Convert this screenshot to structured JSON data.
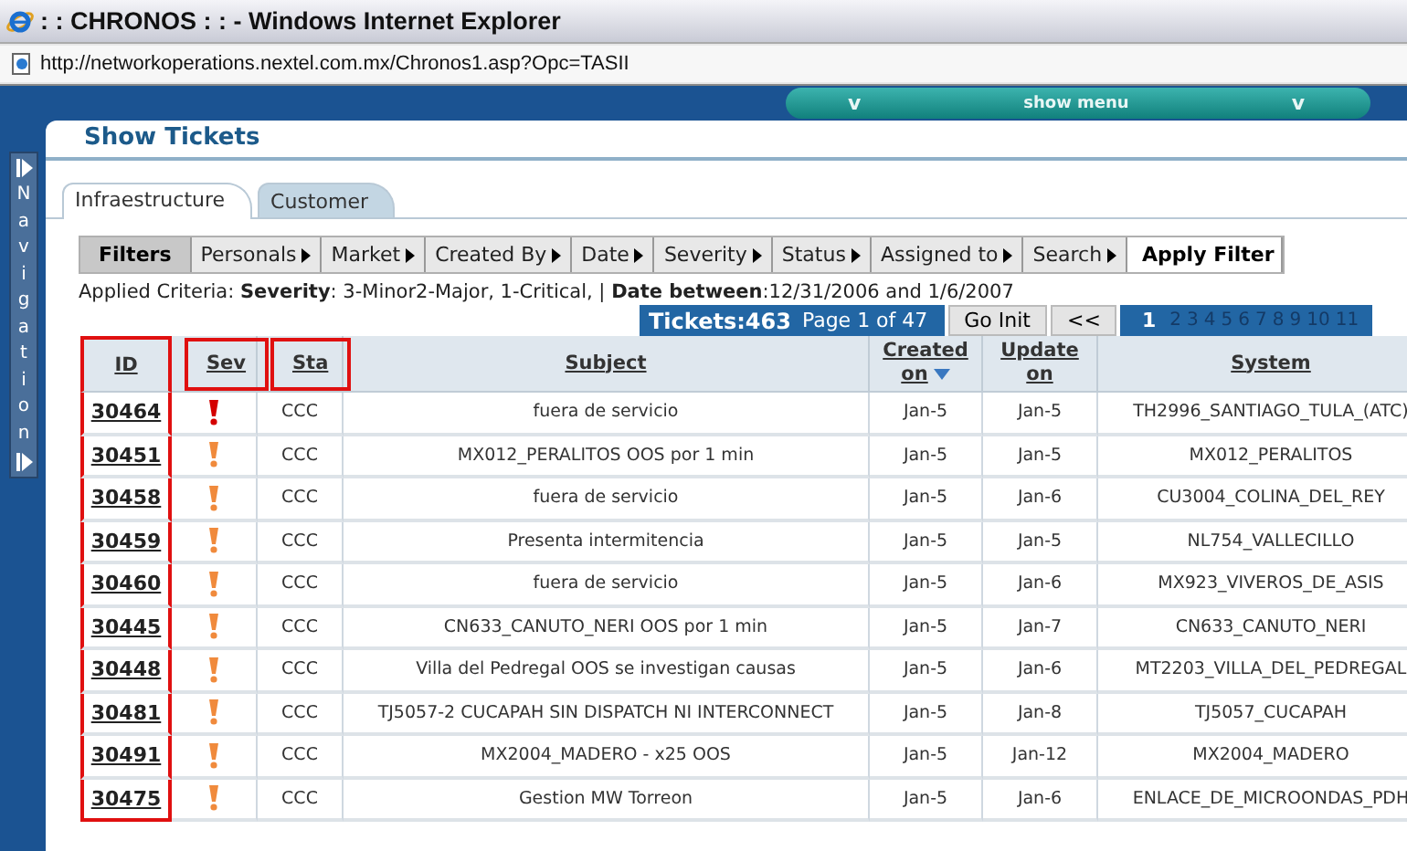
{
  "window": {
    "title": ": : CHRONOS : : - Windows Internet Explorer"
  },
  "address": "http://networkoperations.nextel.com.mx/Chronos1.asp?Opc=TASII",
  "menu_bar": {
    "left_icon": "v",
    "label": "show menu",
    "right_icon": "v"
  },
  "navigation": {
    "label": "Navigation"
  },
  "page_title": "Show Tickets",
  "tabs": [
    {
      "label": "Infraestructure",
      "selected": true
    },
    {
      "label": "Customer",
      "selected": false
    }
  ],
  "filters": [
    {
      "label": "Filters",
      "kind": "heading"
    },
    {
      "label": "Personals",
      "kind": "menu"
    },
    {
      "label": "Market",
      "kind": "menu"
    },
    {
      "label": "Created By",
      "kind": "menu"
    },
    {
      "label": "Date",
      "kind": "menu"
    },
    {
      "label": "Severity",
      "kind": "menu"
    },
    {
      "label": "Status",
      "kind": "menu"
    },
    {
      "label": "Assigned to",
      "kind": "menu"
    },
    {
      "label": "Search",
      "kind": "menu"
    },
    {
      "label": "Apply Filter",
      "kind": "action"
    }
  ],
  "applied_criteria": "Applied Criteria: **Severity**: 3-Minor2-Major, 1-Critical, | **Date between**:12/31/2006 and 1/6/2007",
  "pager": {
    "tickets": "Tickets:463",
    "page": "Page 1 of 47",
    "go_init": "Go Init",
    "prev": "<<",
    "pages": [
      {
        "label": "1",
        "selected": true
      },
      {
        "label": "2",
        "selected": false
      },
      {
        "label": "3",
        "selected": false
      },
      {
        "label": "4",
        "selected": false
      },
      {
        "label": "5",
        "selected": false
      },
      {
        "label": "6",
        "selected": false
      },
      {
        "label": "7",
        "selected": false
      },
      {
        "label": "8",
        "selected": false
      },
      {
        "label": "9",
        "selected": false
      },
      {
        "label": "10",
        "selected": false
      },
      {
        "label": "11",
        "selected": false
      }
    ]
  },
  "table": {
    "columns": [
      {
        "label": "ID",
        "column_boxed": true,
        "header_boxed": false
      },
      {
        "label": "Sev",
        "column_boxed": false,
        "header_boxed": true
      },
      {
        "label": "Sta",
        "column_boxed": false,
        "header_boxed": true
      },
      {
        "label": "Subject",
        "column_boxed": false,
        "header_boxed": false
      },
      {
        "label": "Created on",
        "column_boxed": false,
        "header_boxed": false,
        "sorted": true
      },
      {
        "label": "Update on",
        "column_boxed": false,
        "header_boxed": false
      },
      {
        "label": "System",
        "column_boxed": false,
        "header_boxed": false
      }
    ],
    "rows": [
      {
        "id": "30464",
        "critical": true,
        "status": "CCC",
        "subject": "fuera de servicio",
        "created": "Jan-5",
        "updated": "Jan-5",
        "system": "TH2996_SANTIAGO_TULA_(ATC)"
      },
      {
        "id": "30451",
        "critical": false,
        "status": "CCC",
        "subject": "MX012_PERALITOS OOS por 1 min",
        "created": "Jan-5",
        "updated": "Jan-5",
        "system": "MX012_PERALITOS"
      },
      {
        "id": "30458",
        "critical": false,
        "status": "CCC",
        "subject": "fuera de servicio",
        "created": "Jan-5",
        "updated": "Jan-6",
        "system": "CU3004_COLINA_DEL_REY"
      },
      {
        "id": "30459",
        "critical": false,
        "status": "CCC",
        "subject": "Presenta intermitencia",
        "created": "Jan-5",
        "updated": "Jan-5",
        "system": "NL754_VALLECILLO"
      },
      {
        "id": "30460",
        "critical": false,
        "status": "CCC",
        "subject": "fuera de servicio",
        "created": "Jan-5",
        "updated": "Jan-6",
        "system": "MX923_VIVEROS_DE_ASIS"
      },
      {
        "id": "30445",
        "critical": false,
        "status": "CCC",
        "subject": "CN633_CANUTO_NERI OOS por 1 min",
        "created": "Jan-5",
        "updated": "Jan-7",
        "system": "CN633_CANUTO_NERI"
      },
      {
        "id": "30448",
        "critical": false,
        "status": "CCC",
        "subject": "Villa del Pedregal OOS se investigan causas",
        "created": "Jan-5",
        "updated": "Jan-6",
        "system": "MT2203_VILLA_DEL_PEDREGAL"
      },
      {
        "id": "30481",
        "critical": false,
        "status": "CCC",
        "subject": "TJ5057-2 CUCAPAH SIN DISPATCH NI INTERCONNECT",
        "created": "Jan-5",
        "updated": "Jan-8",
        "system": "TJ5057_CUCAPAH"
      },
      {
        "id": "30491",
        "critical": false,
        "status": "CCC",
        "subject": "MX2004_MADERO - x25 OOS",
        "created": "Jan-5",
        "updated": "Jan-12",
        "system": "MX2004_MADERO"
      },
      {
        "id": "30475",
        "critical": false,
        "status": "CCC",
        "subject": "Gestion MW Torreon",
        "created": "Jan-5",
        "updated": "Jan-6",
        "system": "ENLACE_DE_MICROONDAS_PDH"
      }
    ]
  }
}
